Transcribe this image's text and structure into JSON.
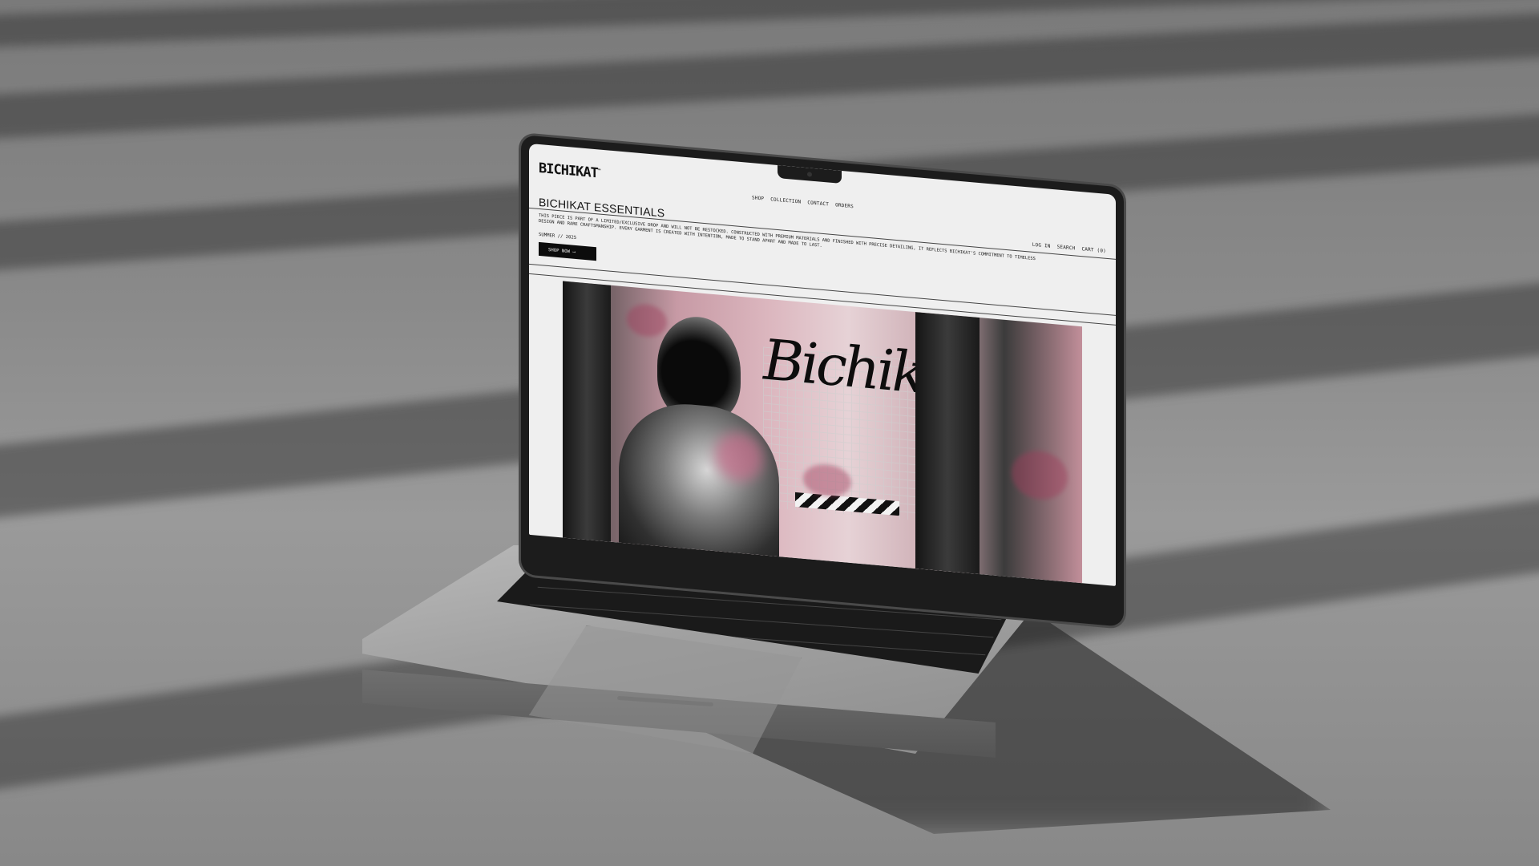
{
  "site": {
    "logo": "BICHIKAT",
    "logo_tm": "™",
    "nav": [
      "SHOP",
      "COLLECTION",
      "CONTACT",
      "ORDERS"
    ],
    "utility": [
      "LOG IN",
      "SEARCH",
      "CART (0)"
    ]
  },
  "hero": {
    "title": "BICHIKAT ESSENTIALS",
    "description": "THIS PIECE IS PART OF A LIMITED/EXCLUSIVE DROP AND WILL NOT BE RESTOCKED. CONSTRUCTED WITH PREMIUM MATERIALS AND FINISHED WITH PRECISE DETAILING, IT REFLECTS BICHIKAT'S COMMITMENT TO TIMELESS DESIGN AND RARE CRAFTSMANSHIP. EVERY GARMENT IS CREATED WITH INTENTION, MADE TO STAND APART AND MADE TO LAST.",
    "season": "SUMMER // 2025",
    "cta": "SHOP NOW ⟶",
    "image_graffiti": "Bichikat"
  },
  "colors": {
    "page_bg": "#efefef",
    "text": "#111111",
    "button_bg": "#0c0c0c",
    "accent_pink": "#c79aa5"
  }
}
